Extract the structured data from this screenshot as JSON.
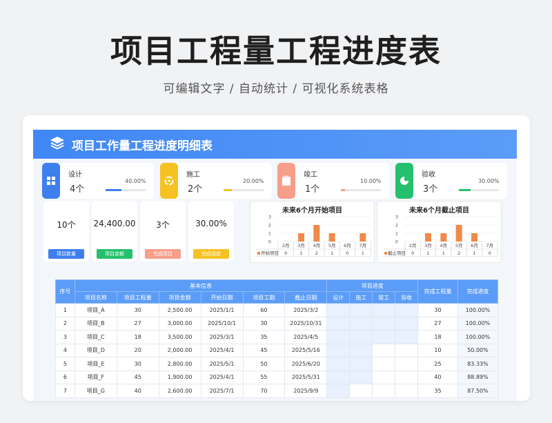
{
  "hero": {
    "title": "项目工程量工程进度表",
    "subtitle": "可编辑文字  /  自动统计  /  可视化系统表格"
  },
  "sheet": {
    "title": "项目工作量工程进度明细表"
  },
  "stages": [
    {
      "name": "设计",
      "count": "4个",
      "pct": "40.00%",
      "fraction": 0.4,
      "color": "#3d7fee",
      "icon": "grid-icon"
    },
    {
      "name": "施工",
      "count": "2个",
      "pct": "20.00%",
      "fraction": 0.2,
      "color": "#f6c223",
      "icon": "recycle-icon"
    },
    {
      "name": "竣工",
      "count": "1个",
      "pct": "10.00%",
      "fraction": 0.1,
      "color": "#f79e8a",
      "icon": "clipboard-icon"
    },
    {
      "name": "验收",
      "count": "3个",
      "pct": "30.00%",
      "fraction": 0.3,
      "color": "#25c06d",
      "icon": "pie-icon"
    }
  ],
  "kpis": [
    {
      "value": "10个",
      "label": "项目数量",
      "color": "#3d7fee"
    },
    {
      "value": "24,400.00",
      "label": "项目金额",
      "color": "#25c06d"
    },
    {
      "value": "3个",
      "label": "完成项目",
      "color": "#f79e8a"
    },
    {
      "value": "30.00%",
      "label": "完成进度",
      "color": "#f6c223"
    }
  ],
  "chart_data": [
    {
      "type": "bar",
      "title": "未来6个月开始项目",
      "categories": [
        "2月",
        "3月",
        "4月",
        "5月",
        "6月",
        "7月"
      ],
      "series": [
        {
          "name": "开始项目",
          "values": [
            0,
            1,
            2,
            1,
            0,
            1
          ]
        }
      ],
      "yticks": [
        "0",
        "1",
        "2",
        "3"
      ],
      "ylim": [
        0,
        3
      ],
      "color": "#ef8a4a",
      "grid": true
    },
    {
      "type": "bar",
      "title": "未来6个月截止项目",
      "categories": [
        "2月",
        "3月",
        "4月",
        "5月",
        "6月",
        "7月"
      ],
      "series": [
        {
          "name": "截止项目",
          "values": [
            0,
            1,
            1,
            2,
            1,
            0
          ]
        }
      ],
      "yticks": [
        "0",
        "1",
        "2",
        "3"
      ],
      "ylim": [
        0,
        3
      ],
      "color": "#ef8a4a",
      "grid": true
    }
  ],
  "table": {
    "group_basic": "基本信息",
    "group_progress": "项目进度",
    "headers": {
      "index": "序号",
      "name": "项目名称",
      "qty": "项目工程量",
      "amount": "项目金额",
      "start": "开始日期",
      "days": "项目工期",
      "end": "截止日期",
      "design": "设计",
      "build": "施工",
      "complete": "竣工",
      "accept": "验收",
      "done_qty": "完成工程量",
      "done_pct": "完成进度"
    },
    "rows": [
      [
        "1",
        "项目_A",
        "30",
        "2,500.00",
        "2025/1/1",
        "60",
        "2025/3/2",
        "30",
        "100.00%"
      ],
      [
        "2",
        "项目_B",
        "27",
        "3,000.00",
        "2025/10/1",
        "30",
        "2025/10/31",
        "27",
        "100.00%"
      ],
      [
        "3",
        "项目_C",
        "18",
        "3,500.00",
        "2025/3/1",
        "35",
        "2025/4/5",
        "18",
        "100.00%"
      ],
      [
        "4",
        "项目_D",
        "20",
        "2,000.00",
        "2025/4/1",
        "45",
        "2025/5/16",
        "10",
        "50.00%"
      ],
      [
        "5",
        "项目_E",
        "30",
        "2,800.00",
        "2025/5/1",
        "50",
        "2025/6/20",
        "25",
        "83.33%"
      ],
      [
        "6",
        "项目_F",
        "45",
        "1,900.00",
        "2025/4/1",
        "55",
        "2025/5/31",
        "40",
        "88.89%"
      ],
      [
        "7",
        "项目_G",
        "40",
        "2,600.00",
        "2025/7/1",
        "70",
        "2025/9/9",
        "35",
        "87.50%"
      ]
    ],
    "progress_fill": [
      [
        1,
        1,
        1,
        1
      ],
      [
        1,
        1,
        1,
        1
      ],
      [
        1,
        1,
        1,
        1
      ],
      [
        1,
        1,
        0,
        0
      ],
      [
        1,
        1,
        0,
        0
      ],
      [
        1,
        1,
        0,
        0
      ],
      [
        1,
        0,
        0,
        0
      ]
    ]
  }
}
